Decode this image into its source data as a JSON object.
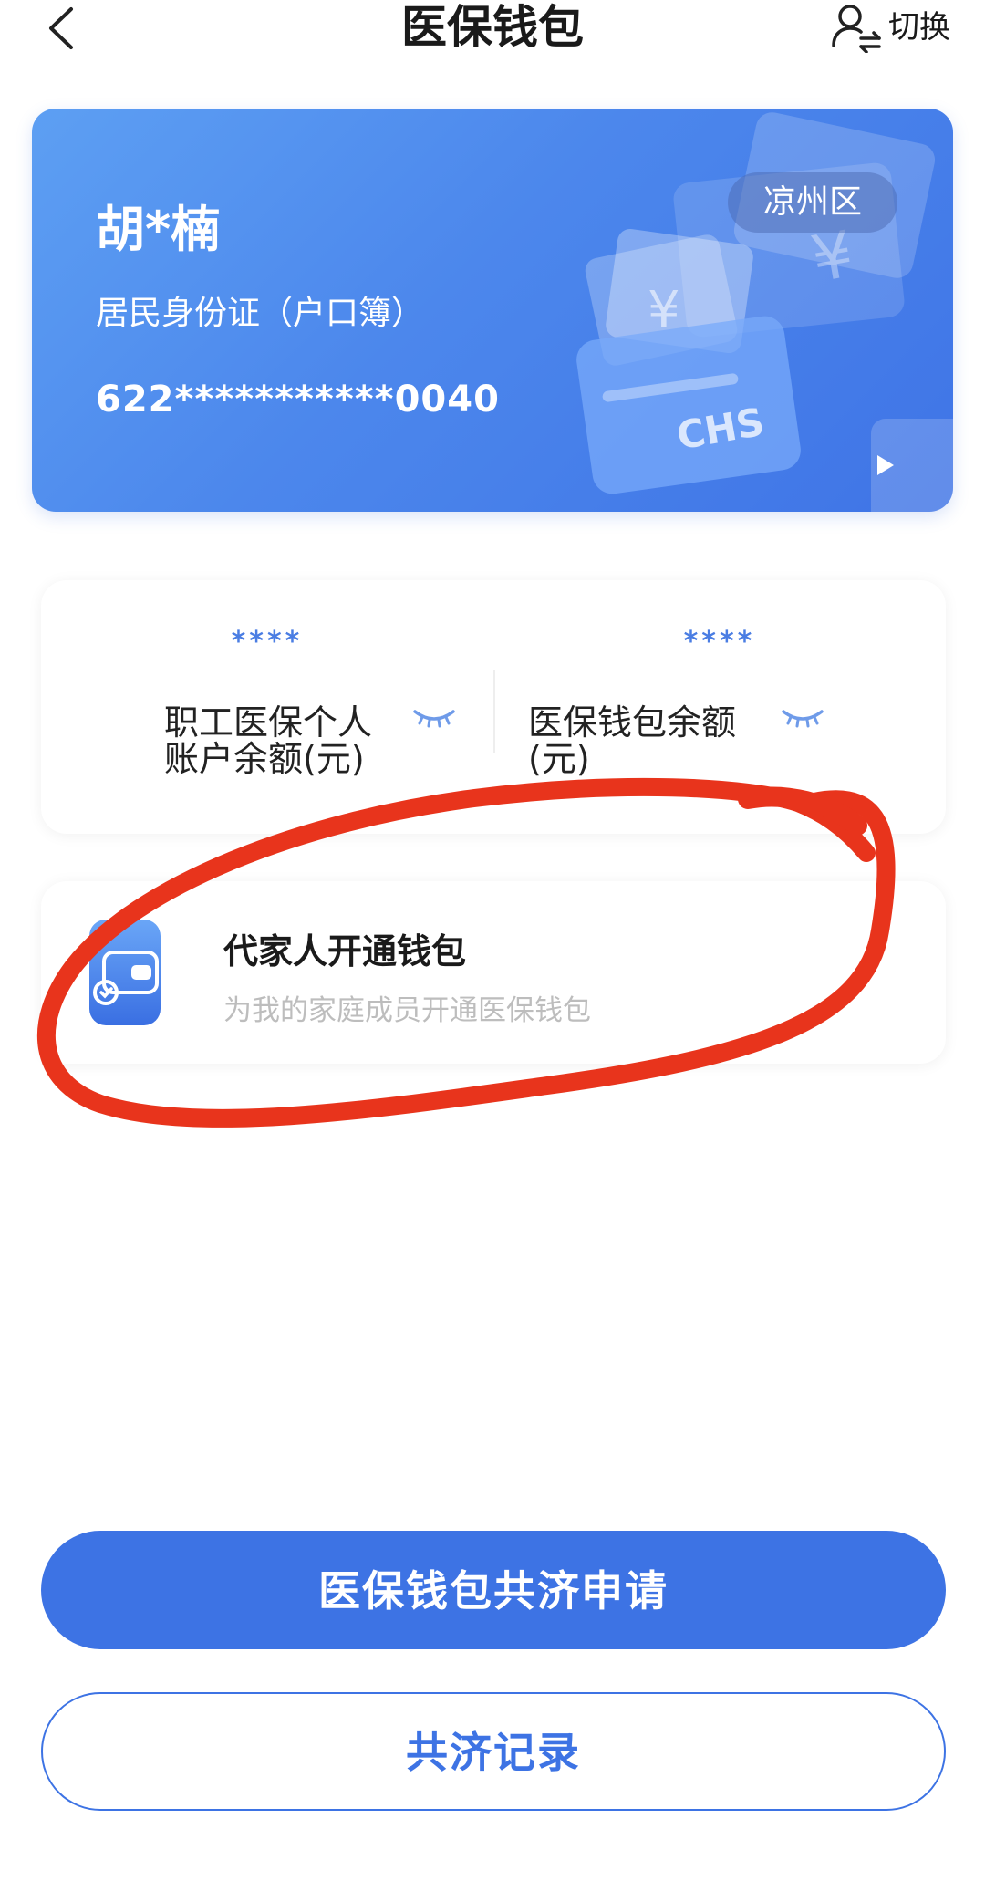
{
  "header": {
    "title": "医保钱包",
    "switch_label": "切换",
    "back_icon": "chevron-left-icon",
    "switch_icon": "user-switch-icon"
  },
  "card": {
    "name": "胡*楠",
    "id_type": "居民身份证（户口簿）",
    "number": "622***********0040",
    "region": "凉州区",
    "logo_text": "CHS",
    "colors": {
      "gradient_start": "#5d9ff3",
      "gradient_end": "#3f74e6"
    }
  },
  "balances": [
    {
      "masked": "****",
      "label": "职工医保个人账户余额(元)",
      "icon": "eye-closed-icon"
    },
    {
      "masked": "****",
      "label": "医保钱包余额(元)",
      "icon": "eye-closed-icon"
    }
  ],
  "family_wallet": {
    "title": "代家人开通钱包",
    "subtitle": "为我的家庭成员开通医保钱包",
    "icon": "wallet-icon"
  },
  "buttons": {
    "primary": "医保钱包共济申请",
    "secondary": "共济记录"
  },
  "colors": {
    "accent": "#3d73e4",
    "annotation": "#e8341c"
  }
}
